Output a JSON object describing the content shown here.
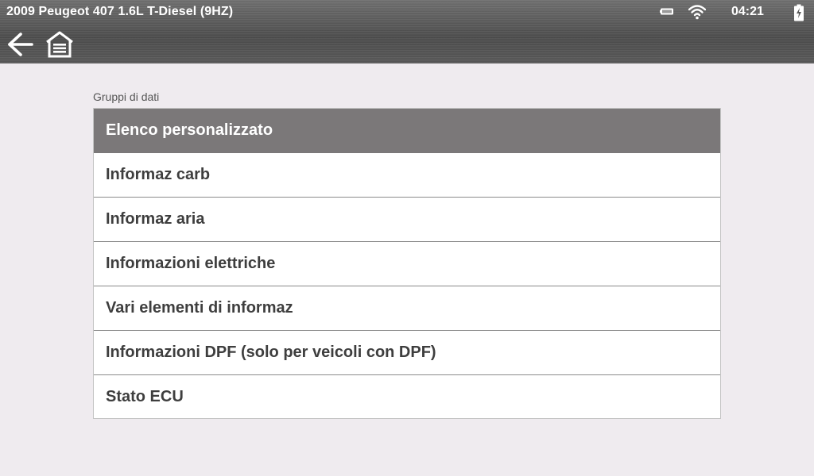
{
  "status": {
    "title": "2009 Peugeot 407 1.6L T-Diesel (9HZ)",
    "time": "04:21",
    "icons": [
      "battery-icon",
      "wifi-icon",
      "battery-charging-icon"
    ]
  },
  "toolbar": {
    "back_icon": "back-arrow-icon",
    "home_icon": "home-garage-icon"
  },
  "main": {
    "section_label": "Gruppi di dati",
    "items": [
      {
        "label": "Elenco personalizzato",
        "selected": true
      },
      {
        "label": "Informaz carb",
        "selected": false
      },
      {
        "label": "Informaz aria",
        "selected": false
      },
      {
        "label": "Informazioni elettriche",
        "selected": false
      },
      {
        "label": "Vari elementi di informaz",
        "selected": false
      },
      {
        "label": "Informazioni DPF (solo per veicoli con DPF)",
        "selected": false
      },
      {
        "label": "Stato ECU",
        "selected": false
      }
    ]
  },
  "colors": {
    "background": "#efebef",
    "selected_row": "#7b7879",
    "row_text": "#3e3e3e",
    "header_text": "#ffffff"
  }
}
